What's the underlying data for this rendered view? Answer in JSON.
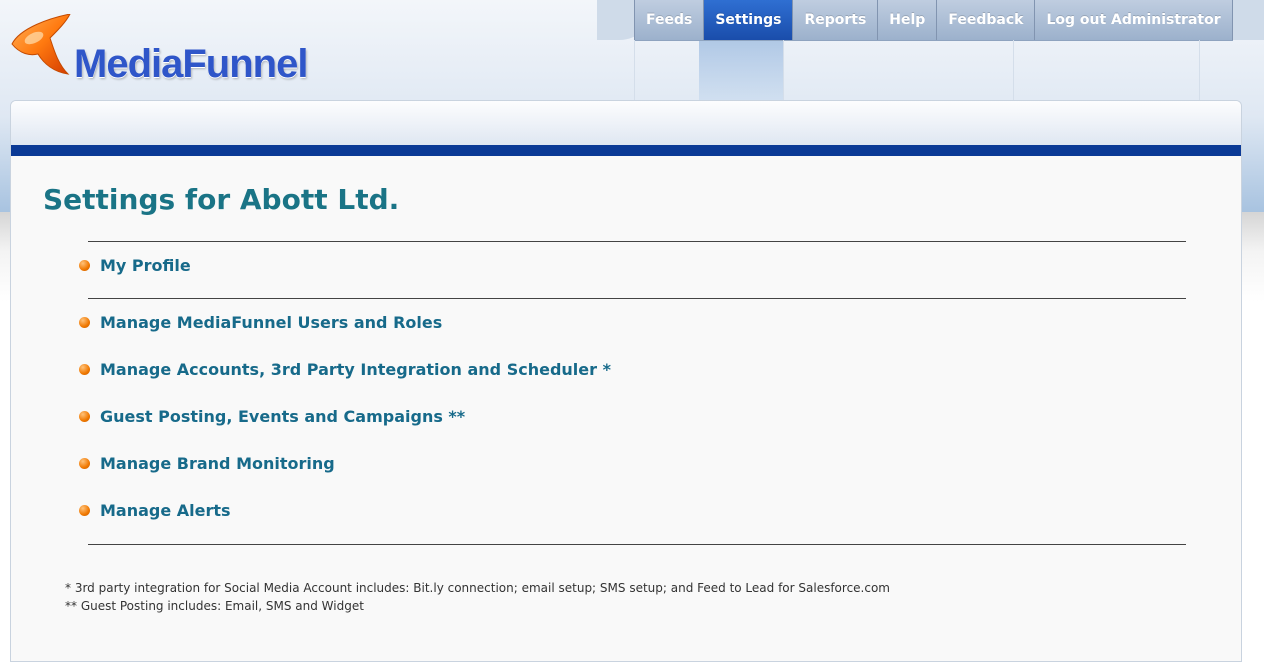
{
  "app": {
    "logo_text": "MediaFunnel"
  },
  "nav": {
    "items": [
      {
        "label": "Feeds"
      },
      {
        "label": "Settings",
        "active": true
      },
      {
        "label": "Reports"
      },
      {
        "label": "Help"
      },
      {
        "label": "Feedback"
      },
      {
        "label": "Log out Administrator"
      }
    ]
  },
  "page": {
    "title": "Settings for Abott Ltd."
  },
  "menu": {
    "items": [
      {
        "label": "My Profile"
      },
      {
        "label": "Manage MediaFunnel Users and Roles"
      },
      {
        "label": "Manage Accounts, 3rd Party Integration and Scheduler *"
      },
      {
        "label": "Guest Posting, Events and Campaigns **"
      },
      {
        "label": "Manage Brand Monitoring"
      },
      {
        "label": "Manage Alerts"
      }
    ]
  },
  "footnotes": [
    "* 3rd party integration for Social Media Account includes: Bit.ly connection; email setup; SMS setup; and Feed to Lead for Salesforce.com",
    "** Guest Posting includes: Email, SMS and Widget"
  ],
  "colors": {
    "accent": "#176a8a",
    "title": "#1a7486",
    "active_tab": "#1a4dab",
    "bullet": "#f07800",
    "header_bar": "#0b3a96"
  }
}
